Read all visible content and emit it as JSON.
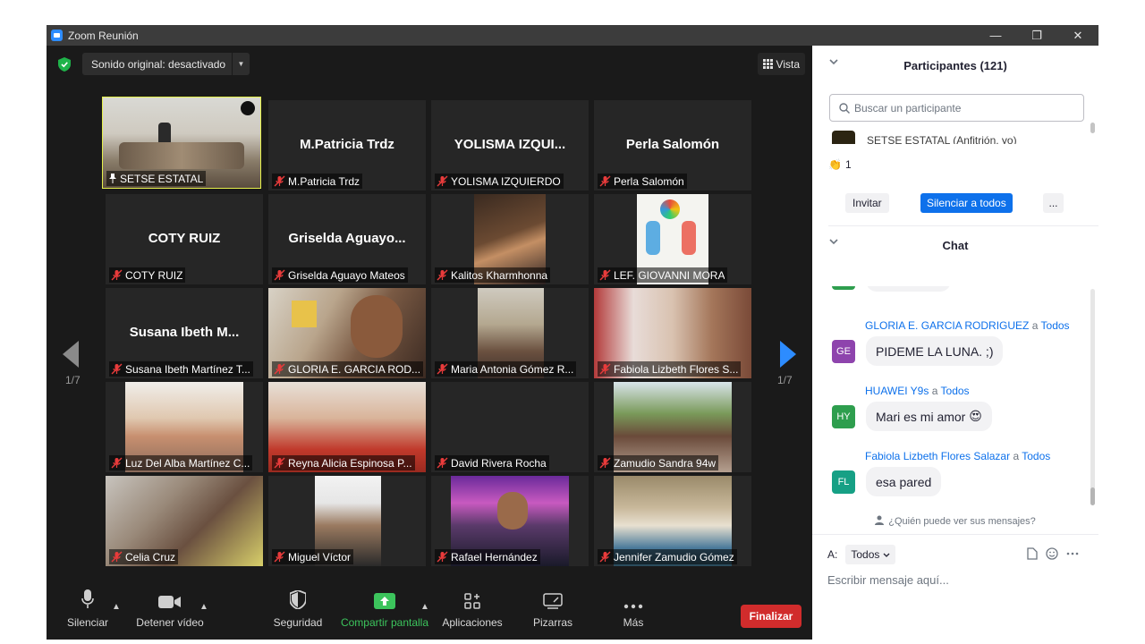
{
  "window": {
    "title": "Zoom Reunión",
    "minimize": "—",
    "restore": "❐",
    "close": "✕"
  },
  "topbar": {
    "sound_label": "Sonido original: desactivado",
    "view_label": "Vista"
  },
  "page": {
    "current": "1/7",
    "left_label": "1/7",
    "right_label": "1/7"
  },
  "tiles": [
    {
      "label": "SETSE ESTATAL",
      "big": "",
      "video": true,
      "active": true,
      "pinned": true
    },
    {
      "label": "M.Patricia Trdz",
      "big": "M.Patricia Trdz",
      "video": false
    },
    {
      "label": "YOLISMA IZQUIERDO",
      "big": "YOLISMA  IZQUI...",
      "video": false
    },
    {
      "label": "Perla Salomón",
      "big": "Perla Salomón",
      "video": false
    },
    {
      "label": "COTY RUIZ",
      "big": "COTY RUIZ",
      "video": false
    },
    {
      "label": "Griselda Aguayo Mateos",
      "big": "Griselda  Aguayo...",
      "video": false
    },
    {
      "label": "Kalitos Kharmhonna",
      "big": "",
      "video": true
    },
    {
      "label": "LEF. GIOVANNI MORA",
      "big": "",
      "video": true
    },
    {
      "label": "Susana Ibeth Martínez T...",
      "big": "Susana  Ibeth  M...",
      "video": false
    },
    {
      "label": "GLORIA E. GARCIA ROD...",
      "big": "",
      "video": true
    },
    {
      "label": "Maria Antonia Gómez R...",
      "big": "",
      "video": true
    },
    {
      "label": "Fabiola Lizbeth Flores S...",
      "big": "",
      "video": true
    },
    {
      "label": "Luz Del Alba Martínez C...",
      "big": "",
      "video": true
    },
    {
      "label": "Reyna Alicia Espinosa P...",
      "big": "",
      "video": true
    },
    {
      "label": "David Rivera Rocha",
      "big": "",
      "video": false
    },
    {
      "label": "Zamudio Sandra 94w",
      "big": "",
      "video": true
    },
    {
      "label": "Celia Cruz",
      "big": "",
      "video": true
    },
    {
      "label": "Miguel Víctor",
      "big": "",
      "video": true
    },
    {
      "label": "Rafael Hernández",
      "big": "",
      "video": true
    },
    {
      "label": "Jennifer Zamudio Gómez",
      "big": "",
      "video": true
    }
  ],
  "toolbar": {
    "mute": "Silenciar",
    "stop_video": "Detener vídeo",
    "security": "Seguridad",
    "share": "Compartir pantalla",
    "apps": "Aplicaciones",
    "whiteboard": "Pizarras",
    "more": "Más",
    "end": "Finalizar"
  },
  "participants": {
    "title": "Participantes (121)",
    "search_placeholder": "Buscar un participante",
    "host_row": "SETSE ESTATAL (Anfitrión, yo)",
    "clap_count": "1",
    "invite": "Invitar",
    "mute_all": "Silenciar a todos",
    "more": "..."
  },
  "chat": {
    "title": "Chat",
    "to_word": "a",
    "messages": [
      {
        "from": "GLORIA E. GARCIA RODRIGUEZ",
        "to": "Todos",
        "initials": "GE",
        "color": "#8e44ad",
        "text": "PIDEME LA LUNA. ;)",
        "emoji": ""
      },
      {
        "from": "HUAWEI Y9s",
        "to": "Todos",
        "initials": "HY",
        "color": "#2e9e4e",
        "text": "Mari es mi amor",
        "emoji": "😍"
      },
      {
        "from": "Fabiola Lizbeth Flores Salazar",
        "to": "Todos",
        "initials": "FL",
        "color": "#16a085",
        "text": "esa pared",
        "emoji": ""
      }
    ],
    "who_can_see": "¿Quién puede ver sus mensajes?",
    "to_label": "A:",
    "recipient": "Todos",
    "input_placeholder": "Escribir mensaje aquí..."
  },
  "colors": {
    "active_speaker": "#e5f04b",
    "end_button": "#d12c2c",
    "accent": "#0e71eb",
    "share_green": "#3cc45c"
  }
}
